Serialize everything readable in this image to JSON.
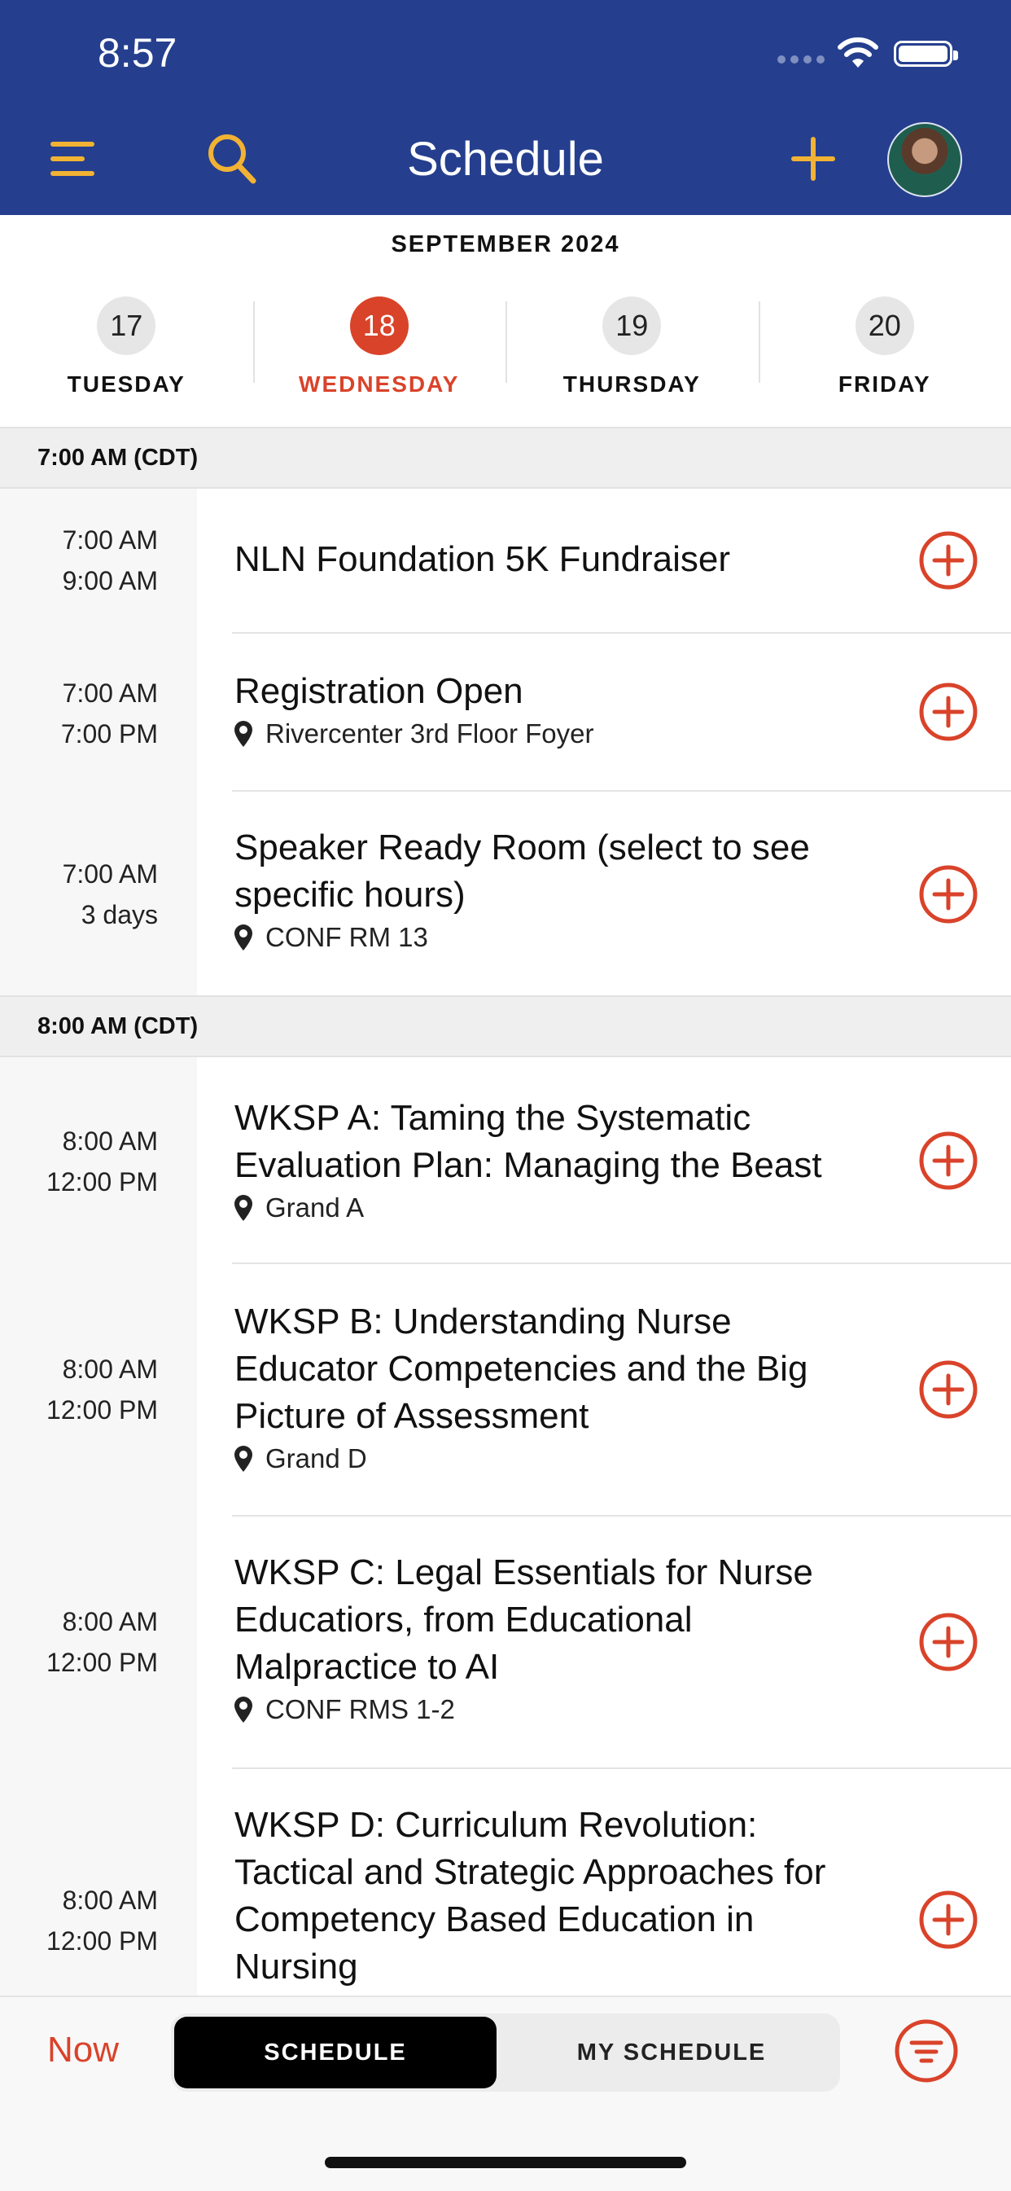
{
  "status_bar": {
    "time": "8:57"
  },
  "header": {
    "title": "Schedule",
    "bg_color": "#253f8e",
    "accent_color": "#f2b233",
    "icons": [
      "menu-icon",
      "search-icon",
      "plus-icon",
      "avatar"
    ]
  },
  "calendar": {
    "month": "SEPTEMBER 2024",
    "days": [
      {
        "num": "17",
        "name": "TUESDAY"
      },
      {
        "num": "18",
        "name": "WEDNESDAY",
        "selected": true
      },
      {
        "num": "19",
        "name": "THURSDAY"
      },
      {
        "num": "20",
        "name": "FRIDAY"
      }
    ]
  },
  "sections": [
    {
      "header": "7:00 AM (CDT)",
      "events": [
        {
          "start": "7:00 AM",
          "end": "9:00 AM",
          "title": "NLN Foundation 5K Fundraiser",
          "location": ""
        },
        {
          "start": "7:00 AM",
          "end": "7:00 PM",
          "title": "Registration Open",
          "location": "Rivercenter 3rd Floor Foyer"
        },
        {
          "start": "7:00 AM",
          "end": "3 days",
          "title": "Speaker Ready Room (select to see specific hours)",
          "location": "CONF RM 13"
        }
      ]
    },
    {
      "header": "8:00 AM (CDT)",
      "events": [
        {
          "start": "8:00 AM",
          "end": "12:00 PM",
          "title": "WKSP A: Taming the Systematic Evaluation Plan:  Managing the Beast",
          "location": "Grand  A"
        },
        {
          "start": "8:00 AM",
          "end": "12:00 PM",
          "title": "WKSP B: Understanding Nurse Educator Competencies and the Big Picture of Assessment",
          "location": "Grand D"
        },
        {
          "start": "8:00 AM",
          "end": "12:00 PM",
          "title": "WKSP C: Legal Essentials for Nurse Educatiors, from Educational Malpractice to AI",
          "location": "CONF RMS 1-2"
        },
        {
          "start": "8:00 AM",
          "end": "12:00 PM",
          "title": "WKSP D: Curriculum Revolution: Tactical and Strategic Approaches for Competency Based Education in Nursing",
          "location": ""
        }
      ]
    }
  ],
  "bottom_bar": {
    "now_label": "Now",
    "tabs": [
      "SCHEDULE",
      "MY SCHEDULE"
    ],
    "active_tab": "SCHEDULE",
    "accent_color": "#d9432a"
  }
}
